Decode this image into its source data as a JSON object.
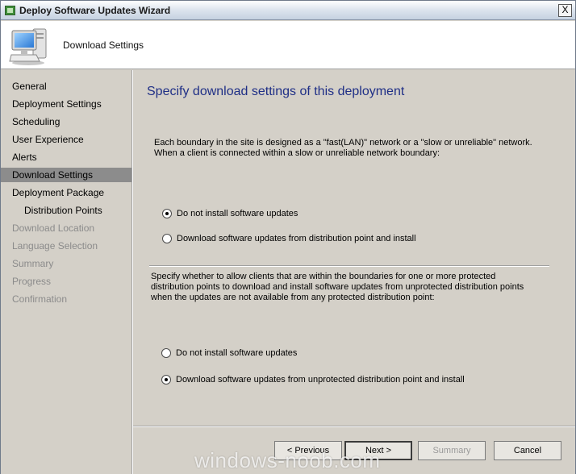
{
  "window": {
    "title": "Deploy Software Updates Wizard",
    "close_label": "X"
  },
  "header": {
    "title": "Download Settings",
    "icon": "computer-icon"
  },
  "sidebar": {
    "items": [
      {
        "label": "General",
        "state": "normal"
      },
      {
        "label": "Deployment Settings",
        "state": "normal"
      },
      {
        "label": "Scheduling",
        "state": "normal"
      },
      {
        "label": "User Experience",
        "state": "normal"
      },
      {
        "label": "Alerts",
        "state": "normal"
      },
      {
        "label": "Download Settings",
        "state": "active"
      },
      {
        "label": "Deployment Package",
        "state": "normal"
      },
      {
        "label": "Distribution Points",
        "state": "sub"
      },
      {
        "label": "Download Location",
        "state": "disabled"
      },
      {
        "label": "Language Selection",
        "state": "disabled"
      },
      {
        "label": "Summary",
        "state": "disabled"
      },
      {
        "label": "Progress",
        "state": "disabled"
      },
      {
        "label": "Confirmation",
        "state": "disabled"
      }
    ]
  },
  "main": {
    "heading": "Specify download settings of this deployment",
    "section1": {
      "description_line1": "Each boundary in the site is designed as a \"fast(LAN)\" network or a \"slow or unreliable\" network.",
      "description_line2": "When a client is connected within a slow or unreliable network boundary:",
      "options": [
        {
          "label": "Do not install software updates",
          "checked": true
        },
        {
          "label": "Download software updates from distribution point and install",
          "checked": false
        }
      ]
    },
    "section2": {
      "description_line1": "Specify whether to allow clients that are within the boundaries for one or more protected",
      "description_line2": "distribution points to download and install software updates from unprotected distribution points",
      "description_line3": "when the updates are not available from any protected distribution point:",
      "options": [
        {
          "label": "Do not install software updates",
          "checked": false
        },
        {
          "label": "Download software updates from unprotected distribution point and install",
          "checked": true
        }
      ]
    }
  },
  "buttons": {
    "previous": "< Previous",
    "next": "Next >",
    "summary": "Summary",
    "cancel": "Cancel"
  },
  "watermark": "windows-noob.com"
}
